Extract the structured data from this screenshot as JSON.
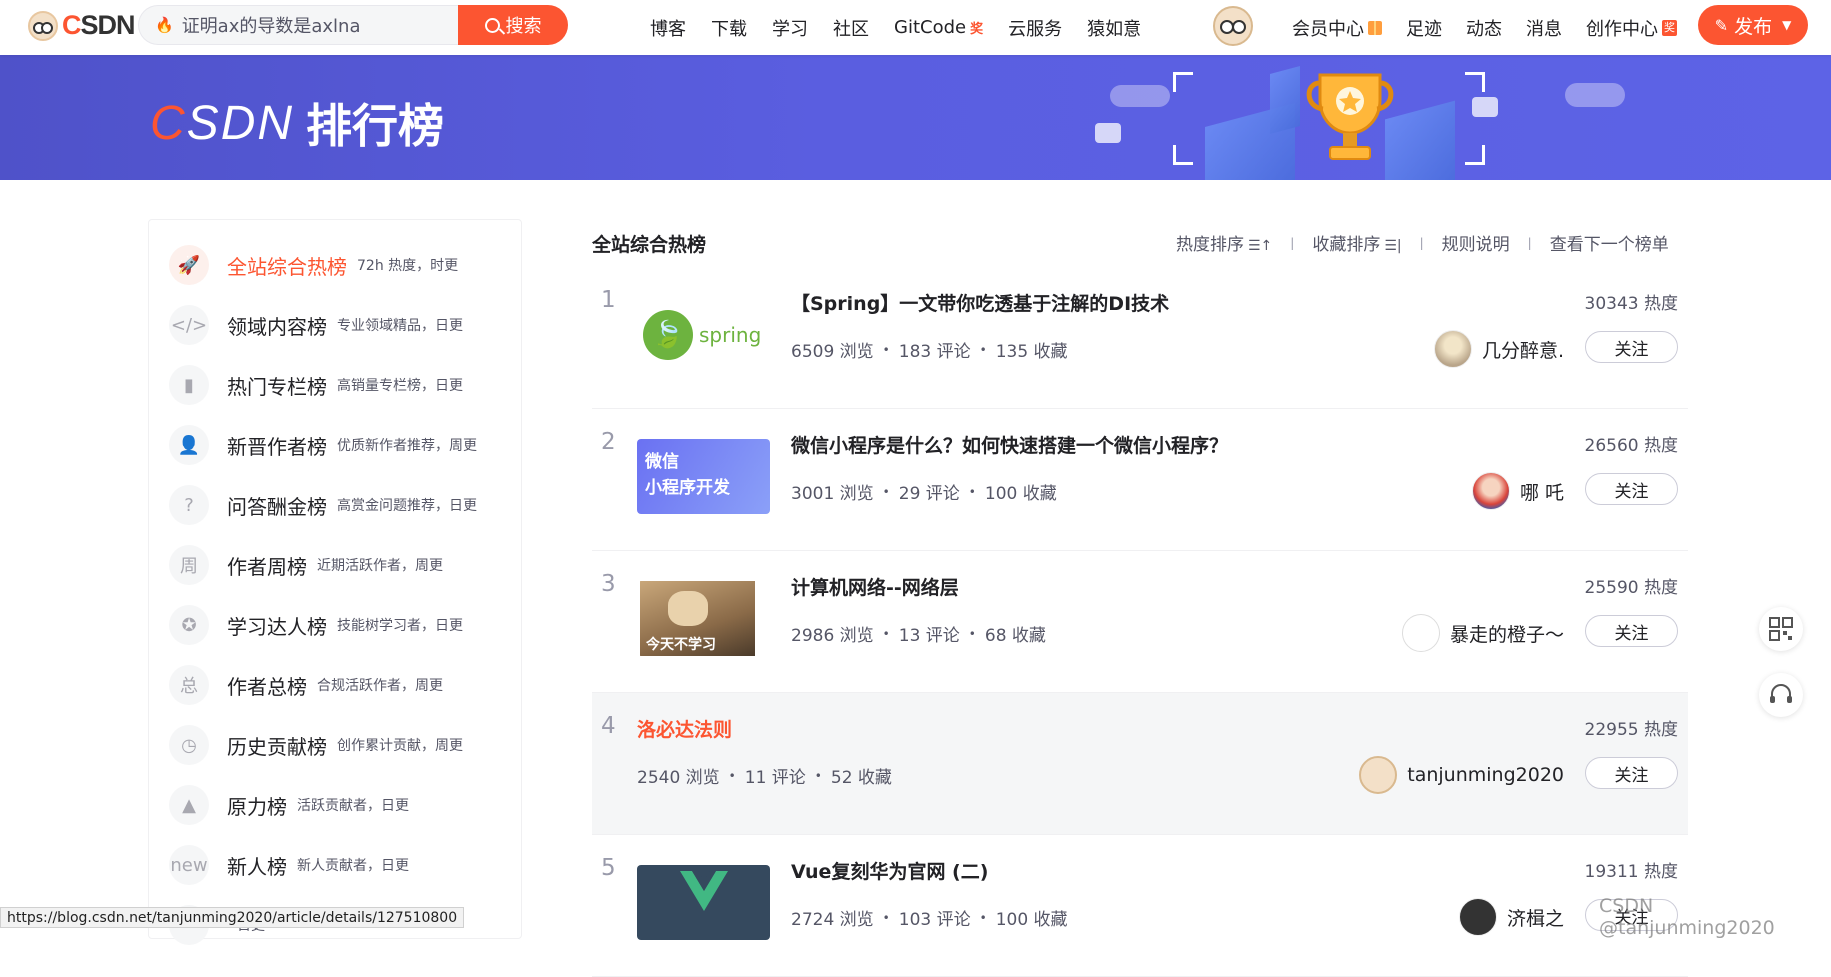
{
  "header": {
    "logo_text": "CSDN",
    "search_value": "证明ax的导数是axlna",
    "search_button": "搜索",
    "nav": [
      "博客",
      "下载",
      "学习",
      "社区",
      "GitCode",
      "云服务",
      "猿如意"
    ],
    "gitcode_badge": "奖",
    "right_nav": [
      "会员中心",
      "足迹",
      "动态",
      "消息",
      "创作中心"
    ],
    "creator_badge": "奖",
    "publish": "发布"
  },
  "banner": {
    "logo": "CSDN",
    "title": "排行榜"
  },
  "sidebar": {
    "items": [
      {
        "label": "全站综合热榜",
        "desc": "72h 热度，时更",
        "icon": "rocket-icon",
        "glyph": "🚀"
      },
      {
        "label": "领域内容榜",
        "desc": "专业领域精品，日更",
        "icon": "code-icon",
        "glyph": "</>"
      },
      {
        "label": "热门专栏榜",
        "desc": "高销量专栏榜，日更",
        "icon": "book-icon",
        "glyph": "▮"
      },
      {
        "label": "新晋作者榜",
        "desc": "优质新作者推荐，周更",
        "icon": "user-icon",
        "glyph": "👤"
      },
      {
        "label": "问答酬金榜",
        "desc": "高赏金问题推荐，日更",
        "icon": "question-icon",
        "glyph": "?"
      },
      {
        "label": "作者周榜",
        "desc": "近期活跃作者，周更",
        "icon": "calendar-icon",
        "glyph": "周"
      },
      {
        "label": "学习达人榜",
        "desc": "技能树学习者，日更",
        "icon": "medal-icon",
        "glyph": "✪"
      },
      {
        "label": "作者总榜",
        "desc": "合规活跃作者，周更",
        "icon": "total-icon",
        "glyph": "总"
      },
      {
        "label": "历史贡献榜",
        "desc": "创作累计贡献，周更",
        "icon": "clock-icon",
        "glyph": "◷"
      },
      {
        "label": "原力榜",
        "desc": "活跃贡献者，日更",
        "icon": "force-icon",
        "glyph": "▲"
      },
      {
        "label": "新人榜",
        "desc": "新人贡献者，日更",
        "icon": "new-icon",
        "glyph": "new"
      },
      {
        "label": "",
        "desc": "日更",
        "icon": "more-icon",
        "glyph": ""
      }
    ]
  },
  "main": {
    "title": "全站综合热榜",
    "sort": [
      "热度排序",
      "收藏排序",
      "规则说明",
      "查看下一个榜单"
    ],
    "follow_label": "关注",
    "rows": [
      {
        "rank": "1",
        "title": "【Spring】一文带你吃透基于注解的DI技术",
        "heat": "30343 热度",
        "views": "6509 浏览",
        "comments": "183 评论",
        "favs": "135 收藏",
        "author": "几分醉意.",
        "thumb": "spring"
      },
      {
        "rank": "2",
        "title": "微信小程序是什么？如何快速搭建一个微信小程序？",
        "heat": "26560 热度",
        "views": "3001 浏览",
        "comments": "29 评论",
        "favs": "100 收藏",
        "author": "哪 吒",
        "thumb": "wechat",
        "thumb_text1": "微信",
        "thumb_text2": "小程序开发"
      },
      {
        "rank": "3",
        "title": "计算机网络--网络层",
        "heat": "25590 热度",
        "views": "2986 浏览",
        "comments": "13 评论",
        "favs": "68 收藏",
        "author": "暴走的橙子～",
        "thumb": "dog",
        "thumb_text1": "今天不学习"
      },
      {
        "rank": "4",
        "title": "洛必达法则",
        "heat": "22955 热度",
        "views": "2540 浏览",
        "comments": "11 评论",
        "favs": "52 收藏",
        "author": "tanjunming2020",
        "thumb": ""
      },
      {
        "rank": "5",
        "title": "Vue复刻华为官网 (二)",
        "heat": "19311 热度",
        "views": "2724 浏览",
        "comments": "103 评论",
        "favs": "100 收藏",
        "author": "济楫之",
        "thumb": "vue"
      }
    ]
  },
  "status_url": "https://blog.csdn.net/tanjunming2020/article/details/127510800",
  "watermark": "CSDN @tanjunming2020",
  "colors": {
    "accent": "#fc5531",
    "banner": "#5a5ee0"
  }
}
